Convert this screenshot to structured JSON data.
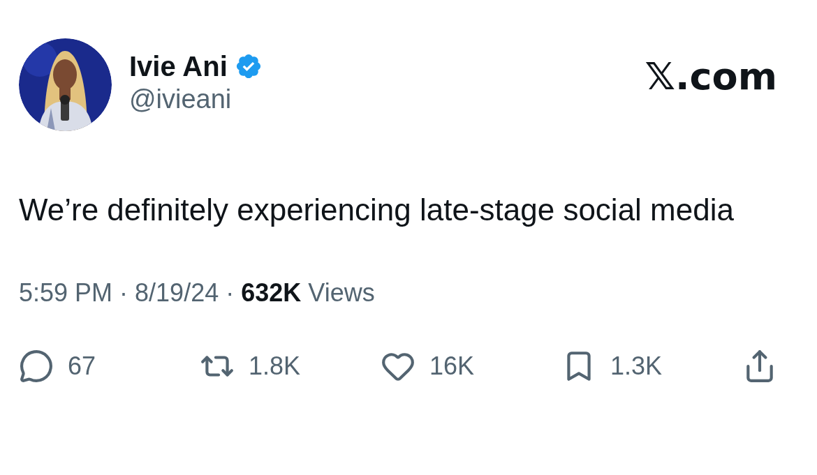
{
  "author": {
    "name": "Ivie Ani",
    "handle": "@ivieani",
    "verified": true
  },
  "brand": "𝕏.com",
  "text": "We’re definitely experiencing late-stage social media",
  "meta": {
    "time": "5:59 PM",
    "separator": "·",
    "date": "8/19/24",
    "views_count": "632K",
    "views_label": "Views"
  },
  "actions": [
    {
      "kind": "reply",
      "count": "67"
    },
    {
      "kind": "repost",
      "count": "1.8K"
    },
    {
      "kind": "like",
      "count": "16K"
    },
    {
      "kind": "bookmark",
      "count": "1.3K"
    },
    {
      "kind": "share"
    }
  ]
}
